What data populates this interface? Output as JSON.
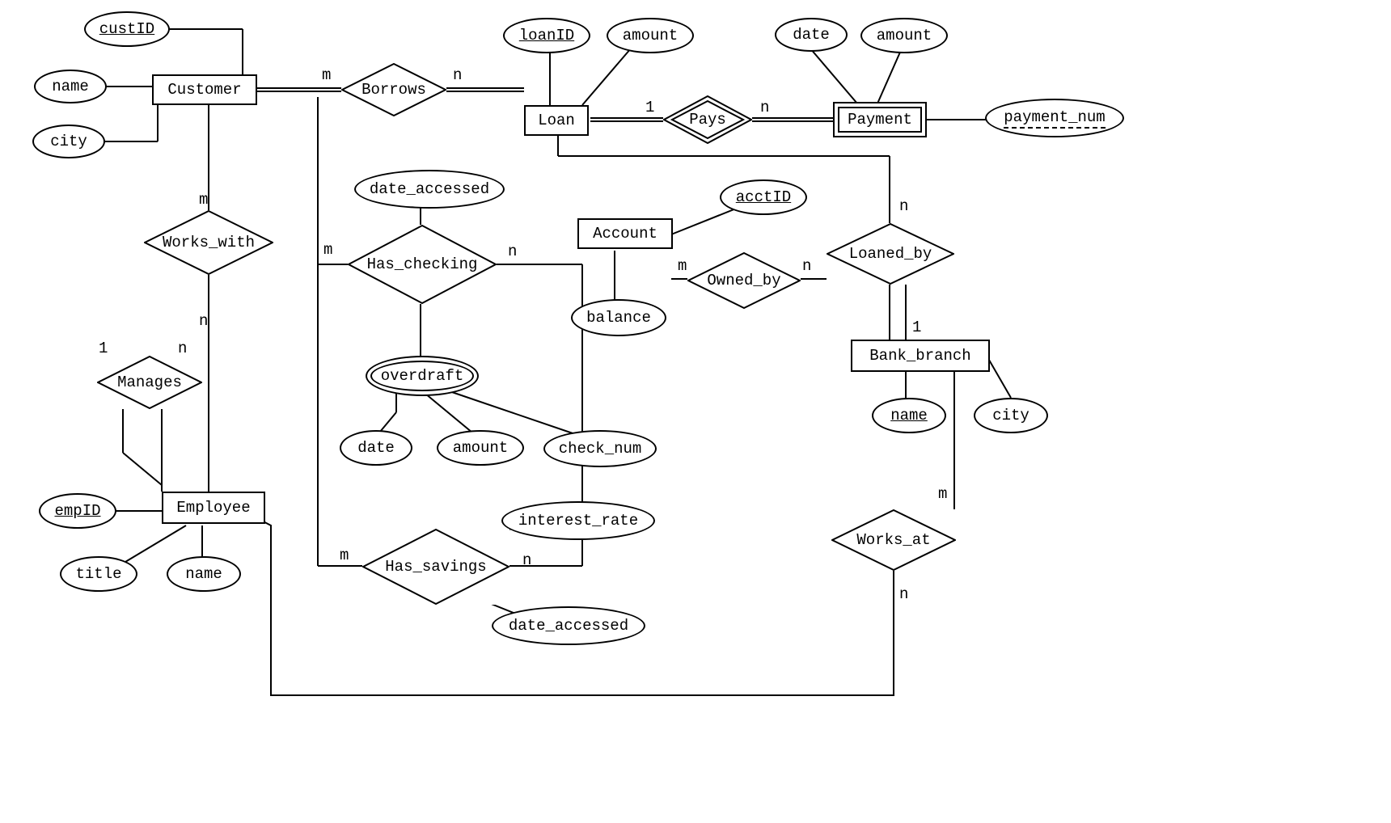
{
  "entities": {
    "customer": "Customer",
    "loan": "Loan",
    "payment": "Payment",
    "account": "Account",
    "bank_branch": "Bank_branch",
    "employee": "Employee"
  },
  "relationships": {
    "borrows": "Borrows",
    "pays": "Pays",
    "works_with": "Works_with",
    "has_checking": "Has_checking",
    "owned_by": "Owned_by",
    "loaned_by": "Loaned_by",
    "manages": "Manages",
    "has_savings": "Has_savings",
    "works_at": "Works_at"
  },
  "attributes": {
    "custID": "custID",
    "cust_name": "name",
    "cust_city": "city",
    "loanID": "loanID",
    "loan_amount": "amount",
    "pay_date": "date",
    "pay_amount": "amount",
    "payment_num": "payment_num",
    "hc_date_accessed": "date_accessed",
    "acctID": "acctID",
    "balance": "balance",
    "overdraft": "overdraft",
    "od_date": "date",
    "od_amount": "amount",
    "od_check_num": "check_num",
    "hs_interest_rate": "interest_rate",
    "hs_date_accessed": "date_accessed",
    "bb_name": "name",
    "bb_city": "city",
    "empID": "empID",
    "emp_title": "title",
    "emp_name": "name"
  },
  "cardinalities": {
    "borrows_m": "m",
    "borrows_n": "n",
    "pays_1": "1",
    "pays_n": "n",
    "ww_m": "m",
    "ww_n": "n",
    "hc_m": "m",
    "hc_n": "n",
    "ob_m": "m",
    "ob_n": "n",
    "lb_n": "n",
    "lb_1": "1",
    "mg_1": "1",
    "mg_n": "n",
    "hs_m": "m",
    "hs_n": "n",
    "wa_m": "m",
    "wa_n": "n"
  }
}
